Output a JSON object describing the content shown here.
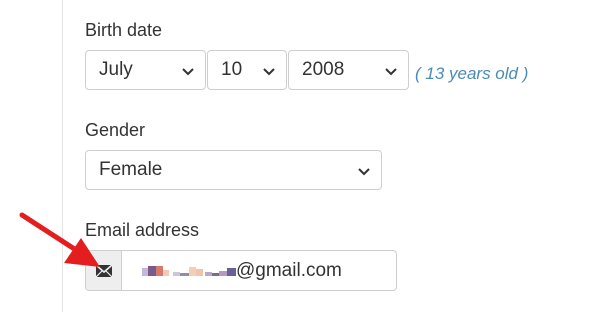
{
  "birth_date": {
    "label": "Birth date",
    "month": "July",
    "day": "10",
    "year": "2008",
    "age_note": "( 13 years old )"
  },
  "gender": {
    "label": "Gender",
    "value": "Female"
  },
  "email": {
    "label": "Email address",
    "icon": "envelope-icon",
    "visible_suffix": "@gmail.com"
  },
  "annotation": {
    "arrow_color": "#e41e1e"
  }
}
